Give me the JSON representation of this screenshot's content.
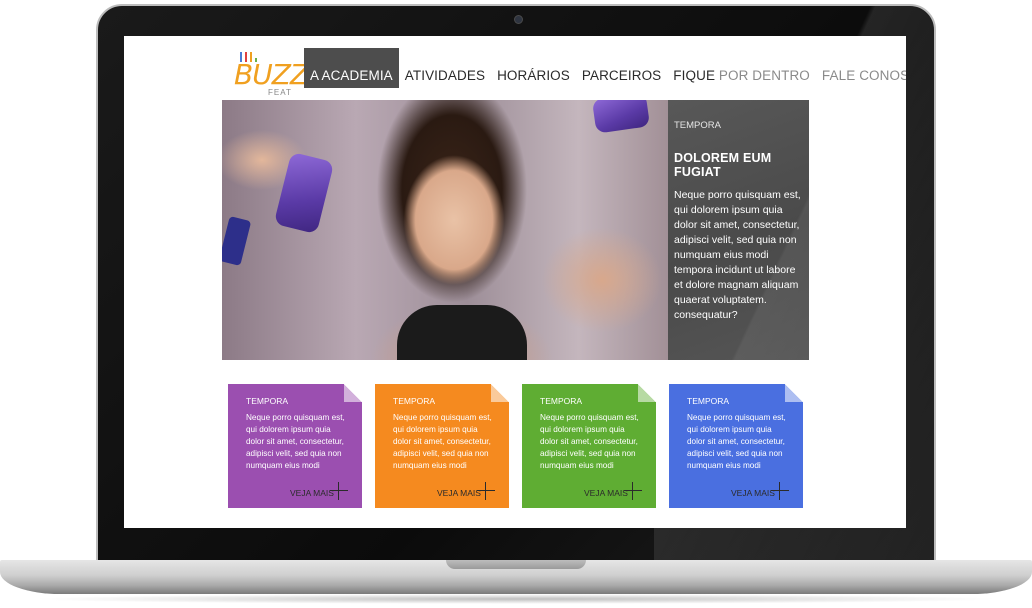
{
  "site": {
    "logo": {
      "word": "BUZZ",
      "sub": "FEAT",
      "bar_colors": [
        "#4a7bd6",
        "#e04040",
        "#f0a020",
        "#6ab04c"
      ]
    },
    "nav": {
      "items": [
        {
          "label": "A ACADEMIA",
          "active": true
        },
        {
          "label": "ATIVIDADES"
        },
        {
          "label": "HORÁRIOS"
        },
        {
          "label": "PARCEIROS"
        },
        {
          "label_main": "FIQUE ",
          "label_light": "POR DENTRO"
        },
        {
          "label_light": "FALE CONOSCO"
        }
      ]
    },
    "hero": {
      "kicker": "TEMPORA",
      "title": "DOLOREM EUM FUGIAT",
      "body": "Neque porro quisquam est, qui dolorem ipsum quia dolor sit amet, consectetur, adipisci velit, sed quia non numquam eius modi tempora incidunt ut labore et dolore magnam aliquam quaerat voluptatem. consequatur?"
    },
    "cards": [
      {
        "kicker": "TEMPORA",
        "body": "Neque porro quisquam est, qui dolorem ipsum quia dolor sit amet, consectetur, adipisci velit, sed quia non numquam eius modi",
        "more": "VEJA MAIS",
        "color": "#9b4fb0"
      },
      {
        "kicker": "TEMPORA",
        "body": "Neque porro quisquam est, qui dolorem ipsum quia dolor sit amet, consectetur, adipisci velit, sed quia non numquam eius modi",
        "more": "VEJA MAIS",
        "color": "#f58a1f"
      },
      {
        "kicker": "TEMPORA",
        "body": "Neque porro quisquam est, qui dolorem ipsum quia dolor sit amet, consectetur, adipisci velit, sed quia non numquam eius modi",
        "more": "VEJA MAIS",
        "color": "#5fad33"
      },
      {
        "kicker": "TEMPORA",
        "body": "Neque porro quisquam est, qui dolorem ipsum quia dolor sit amet, consectetur, adipisci velit, sed quia non numquam eius modi",
        "more": "VEJA MAIS",
        "color": "#4a6fe0"
      }
    ],
    "colors": {
      "nav_active_bg": "#4d4d4d",
      "hero_panel_bg": "#4f4f4f",
      "logo_accent": "#f0a020"
    }
  }
}
